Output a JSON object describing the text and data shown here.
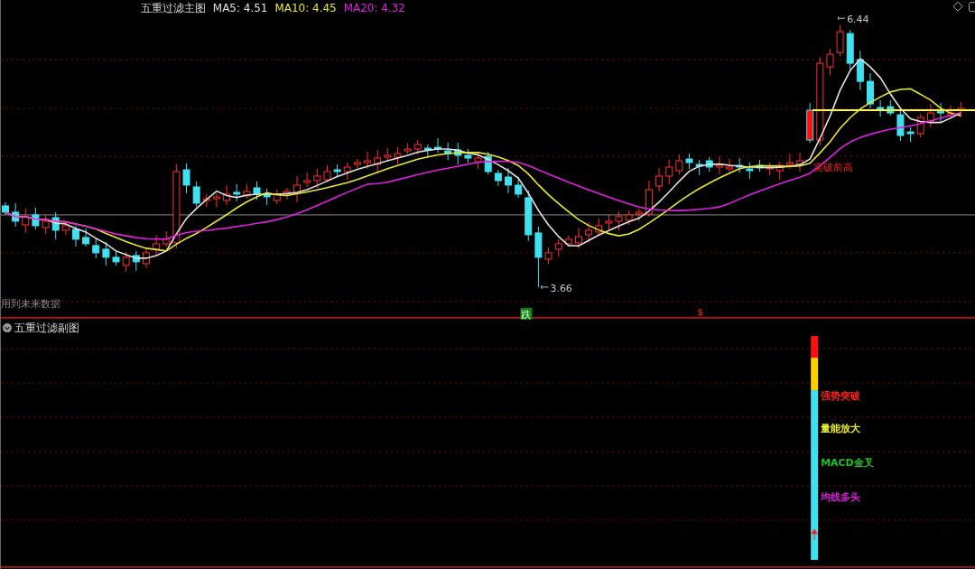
{
  "main_chart": {
    "title": "五重过滤主图",
    "indicators": [
      {
        "label": "MA5: 4.51",
        "color": "#e0e0e0"
      },
      {
        "label": "MA10: 4.45",
        "color": "#e8e830"
      },
      {
        "label": "MA20: 4.32",
        "color": "#e020e0"
      }
    ],
    "annotations": [
      {
        "kind": "high",
        "text": "6.44"
      },
      {
        "kind": "low",
        "text": "3.66"
      },
      {
        "kind": "signal",
        "text": "突破前高"
      }
    ],
    "note": "用到未来数据",
    "markers": [
      {
        "kind": "down",
        "text": "跌"
      },
      {
        "kind": "up",
        "text": "$"
      }
    ]
  },
  "sub_chart": {
    "title": "五重过滤副图",
    "signals": [
      {
        "text": "强势突破",
        "color": "#ff2020"
      },
      {
        "text": "量能放大",
        "color": "#e8e830"
      },
      {
        "text": "MACD金叉",
        "color": "#20c020"
      },
      {
        "text": "均线多头",
        "color": "#d020d0"
      }
    ]
  }
}
